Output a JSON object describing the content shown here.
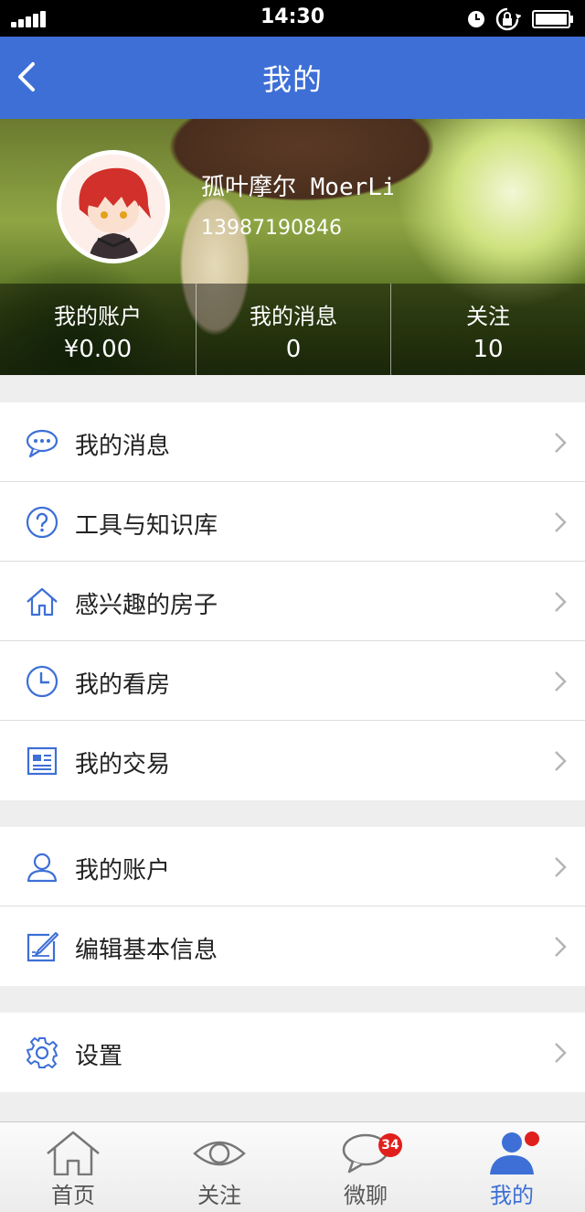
{
  "status_bar": {
    "time": "14:30"
  },
  "nav": {
    "title": "我的"
  },
  "profile": {
    "name": "孤叶摩尔 MoerLi",
    "phone": "13987190846",
    "stats": [
      {
        "label": "我的账户",
        "value": "¥0.00"
      },
      {
        "label": "我的消息",
        "value": "0"
      },
      {
        "label": "关注",
        "value": "10"
      }
    ]
  },
  "menu_groups": [
    [
      {
        "label": "我的消息",
        "icon": "chat-bubble-icon"
      },
      {
        "label": "工具与知识库",
        "icon": "question-circle-icon"
      },
      {
        "label": "感兴趣的房子",
        "icon": "house-icon"
      },
      {
        "label": "我的看房",
        "icon": "clock-icon"
      },
      {
        "label": "我的交易",
        "icon": "document-icon"
      }
    ],
    [
      {
        "label": "我的账户",
        "icon": "user-icon"
      },
      {
        "label": "编辑基本信息",
        "icon": "edit-icon"
      }
    ],
    [
      {
        "label": "设置",
        "icon": "gear-icon"
      }
    ]
  ],
  "tabs": [
    {
      "label": "首页",
      "icon": "home-icon"
    },
    {
      "label": "关注",
      "icon": "eye-icon"
    },
    {
      "label": "微聊",
      "icon": "chat-icon",
      "badge": "34"
    },
    {
      "label": "我的",
      "icon": "person-icon",
      "active": true
    }
  ],
  "colors": {
    "accent": "#3d6fd6",
    "badge": "#e0201d"
  }
}
